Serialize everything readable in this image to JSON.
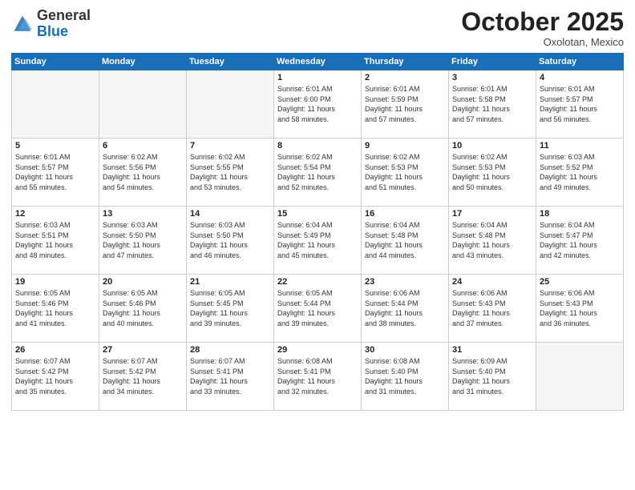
{
  "header": {
    "logo_general": "General",
    "logo_blue": "Blue",
    "month": "October 2025",
    "location": "Oxolotan, Mexico"
  },
  "weekdays": [
    "Sunday",
    "Monday",
    "Tuesday",
    "Wednesday",
    "Thursday",
    "Friday",
    "Saturday"
  ],
  "weeks": [
    [
      {
        "day": "",
        "info": ""
      },
      {
        "day": "",
        "info": ""
      },
      {
        "day": "",
        "info": ""
      },
      {
        "day": "1",
        "info": "Sunrise: 6:01 AM\nSunset: 6:00 PM\nDaylight: 11 hours\nand 58 minutes."
      },
      {
        "day": "2",
        "info": "Sunrise: 6:01 AM\nSunset: 5:59 PM\nDaylight: 11 hours\nand 57 minutes."
      },
      {
        "day": "3",
        "info": "Sunrise: 6:01 AM\nSunset: 5:58 PM\nDaylight: 11 hours\nand 57 minutes."
      },
      {
        "day": "4",
        "info": "Sunrise: 6:01 AM\nSunset: 5:57 PM\nDaylight: 11 hours\nand 56 minutes."
      }
    ],
    [
      {
        "day": "5",
        "info": "Sunrise: 6:01 AM\nSunset: 5:57 PM\nDaylight: 11 hours\nand 55 minutes."
      },
      {
        "day": "6",
        "info": "Sunrise: 6:02 AM\nSunset: 5:56 PM\nDaylight: 11 hours\nand 54 minutes."
      },
      {
        "day": "7",
        "info": "Sunrise: 6:02 AM\nSunset: 5:55 PM\nDaylight: 11 hours\nand 53 minutes."
      },
      {
        "day": "8",
        "info": "Sunrise: 6:02 AM\nSunset: 5:54 PM\nDaylight: 11 hours\nand 52 minutes."
      },
      {
        "day": "9",
        "info": "Sunrise: 6:02 AM\nSunset: 5:53 PM\nDaylight: 11 hours\nand 51 minutes."
      },
      {
        "day": "10",
        "info": "Sunrise: 6:02 AM\nSunset: 5:53 PM\nDaylight: 11 hours\nand 50 minutes."
      },
      {
        "day": "11",
        "info": "Sunrise: 6:03 AM\nSunset: 5:52 PM\nDaylight: 11 hours\nand 49 minutes."
      }
    ],
    [
      {
        "day": "12",
        "info": "Sunrise: 6:03 AM\nSunset: 5:51 PM\nDaylight: 11 hours\nand 48 minutes."
      },
      {
        "day": "13",
        "info": "Sunrise: 6:03 AM\nSunset: 5:50 PM\nDaylight: 11 hours\nand 47 minutes."
      },
      {
        "day": "14",
        "info": "Sunrise: 6:03 AM\nSunset: 5:50 PM\nDaylight: 11 hours\nand 46 minutes."
      },
      {
        "day": "15",
        "info": "Sunrise: 6:04 AM\nSunset: 5:49 PM\nDaylight: 11 hours\nand 45 minutes."
      },
      {
        "day": "16",
        "info": "Sunrise: 6:04 AM\nSunset: 5:48 PM\nDaylight: 11 hours\nand 44 minutes."
      },
      {
        "day": "17",
        "info": "Sunrise: 6:04 AM\nSunset: 5:48 PM\nDaylight: 11 hours\nand 43 minutes."
      },
      {
        "day": "18",
        "info": "Sunrise: 6:04 AM\nSunset: 5:47 PM\nDaylight: 11 hours\nand 42 minutes."
      }
    ],
    [
      {
        "day": "19",
        "info": "Sunrise: 6:05 AM\nSunset: 5:46 PM\nDaylight: 11 hours\nand 41 minutes."
      },
      {
        "day": "20",
        "info": "Sunrise: 6:05 AM\nSunset: 5:46 PM\nDaylight: 11 hours\nand 40 minutes."
      },
      {
        "day": "21",
        "info": "Sunrise: 6:05 AM\nSunset: 5:45 PM\nDaylight: 11 hours\nand 39 minutes."
      },
      {
        "day": "22",
        "info": "Sunrise: 6:05 AM\nSunset: 5:44 PM\nDaylight: 11 hours\nand 39 minutes."
      },
      {
        "day": "23",
        "info": "Sunrise: 6:06 AM\nSunset: 5:44 PM\nDaylight: 11 hours\nand 38 minutes."
      },
      {
        "day": "24",
        "info": "Sunrise: 6:06 AM\nSunset: 5:43 PM\nDaylight: 11 hours\nand 37 minutes."
      },
      {
        "day": "25",
        "info": "Sunrise: 6:06 AM\nSunset: 5:43 PM\nDaylight: 11 hours\nand 36 minutes."
      }
    ],
    [
      {
        "day": "26",
        "info": "Sunrise: 6:07 AM\nSunset: 5:42 PM\nDaylight: 11 hours\nand 35 minutes."
      },
      {
        "day": "27",
        "info": "Sunrise: 6:07 AM\nSunset: 5:42 PM\nDaylight: 11 hours\nand 34 minutes."
      },
      {
        "day": "28",
        "info": "Sunrise: 6:07 AM\nSunset: 5:41 PM\nDaylight: 11 hours\nand 33 minutes."
      },
      {
        "day": "29",
        "info": "Sunrise: 6:08 AM\nSunset: 5:41 PM\nDaylight: 11 hours\nand 32 minutes."
      },
      {
        "day": "30",
        "info": "Sunrise: 6:08 AM\nSunset: 5:40 PM\nDaylight: 11 hours\nand 31 minutes."
      },
      {
        "day": "31",
        "info": "Sunrise: 6:09 AM\nSunset: 5:40 PM\nDaylight: 11 hours\nand 31 minutes."
      },
      {
        "day": "",
        "info": ""
      }
    ]
  ]
}
